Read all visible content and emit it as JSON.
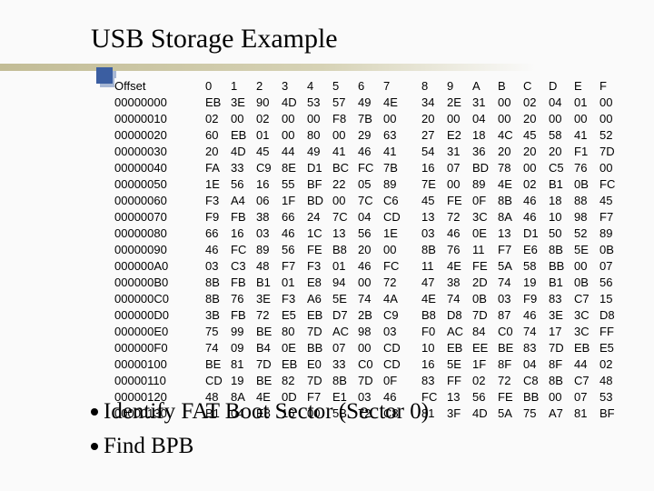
{
  "title": "USB Storage Example",
  "hex": {
    "header": [
      "Offset",
      "0",
      "1",
      "2",
      "3",
      "4",
      "5",
      "6",
      "7",
      "8",
      "9",
      "A",
      "B",
      "C",
      "D",
      "E",
      "F"
    ],
    "rows": [
      {
        "offset": "00000000",
        "bytes": [
          "EB",
          "3E",
          "90",
          "4D",
          "53",
          "57",
          "49",
          "4E",
          "34",
          "2E",
          "31",
          "00",
          "02",
          "04",
          "01",
          "00"
        ]
      },
      {
        "offset": "00000010",
        "bytes": [
          "02",
          "00",
          "02",
          "00",
          "00",
          "F8",
          "7B",
          "00",
          "20",
          "00",
          "04",
          "00",
          "20",
          "00",
          "00",
          "00"
        ]
      },
      {
        "offset": "00000020",
        "bytes": [
          "60",
          "EB",
          "01",
          "00",
          "80",
          "00",
          "29",
          "63",
          "27",
          "E2",
          "18",
          "4C",
          "45",
          "58",
          "41",
          "52"
        ]
      },
      {
        "offset": "00000030",
        "bytes": [
          "20",
          "4D",
          "45",
          "44",
          "49",
          "41",
          "46",
          "41",
          "54",
          "31",
          "36",
          "20",
          "20",
          "20",
          "F1",
          "7D"
        ]
      },
      {
        "offset": "00000040",
        "bytes": [
          "FA",
          "33",
          "C9",
          "8E",
          "D1",
          "BC",
          "FC",
          "7B",
          "16",
          "07",
          "BD",
          "78",
          "00",
          "C5",
          "76",
          "00"
        ]
      },
      {
        "offset": "00000050",
        "bytes": [
          "1E",
          "56",
          "16",
          "55",
          "BF",
          "22",
          "05",
          "89",
          "7E",
          "00",
          "89",
          "4E",
          "02",
          "B1",
          "0B",
          "FC"
        ]
      },
      {
        "offset": "00000060",
        "bytes": [
          "F3",
          "A4",
          "06",
          "1F",
          "BD",
          "00",
          "7C",
          "C6",
          "45",
          "FE",
          "0F",
          "8B",
          "46",
          "18",
          "88",
          "45"
        ]
      },
      {
        "offset": "00000070",
        "bytes": [
          "F9",
          "FB",
          "38",
          "66",
          "24",
          "7C",
          "04",
          "CD",
          "13",
          "72",
          "3C",
          "8A",
          "46",
          "10",
          "98",
          "F7"
        ]
      },
      {
        "offset": "00000080",
        "bytes": [
          "66",
          "16",
          "03",
          "46",
          "1C",
          "13",
          "56",
          "1E",
          "03",
          "46",
          "0E",
          "13",
          "D1",
          "50",
          "52",
          "89"
        ]
      },
      {
        "offset": "00000090",
        "bytes": [
          "46",
          "FC",
          "89",
          "56",
          "FE",
          "B8",
          "20",
          "00",
          "8B",
          "76",
          "11",
          "F7",
          "E6",
          "8B",
          "5E",
          "0B"
        ]
      },
      {
        "offset": "000000A0",
        "bytes": [
          "03",
          "C3",
          "48",
          "F7",
          "F3",
          "01",
          "46",
          "FC",
          "11",
          "4E",
          "FE",
          "5A",
          "58",
          "BB",
          "00",
          "07"
        ]
      },
      {
        "offset": "000000B0",
        "bytes": [
          "8B",
          "FB",
          "B1",
          "01",
          "E8",
          "94",
          "00",
          "72",
          "47",
          "38",
          "2D",
          "74",
          "19",
          "B1",
          "0B",
          "56"
        ]
      },
      {
        "offset": "000000C0",
        "bytes": [
          "8B",
          "76",
          "3E",
          "F3",
          "A6",
          "5E",
          "74",
          "4A",
          "4E",
          "74",
          "0B",
          "03",
          "F9",
          "83",
          "C7",
          "15"
        ]
      },
      {
        "offset": "000000D0",
        "bytes": [
          "3B",
          "FB",
          "72",
          "E5",
          "EB",
          "D7",
          "2B",
          "C9",
          "B8",
          "D8",
          "7D",
          "87",
          "46",
          "3E",
          "3C",
          "D8"
        ]
      },
      {
        "offset": "000000E0",
        "bytes": [
          "75",
          "99",
          "BE",
          "80",
          "7D",
          "AC",
          "98",
          "03",
          "F0",
          "AC",
          "84",
          "C0",
          "74",
          "17",
          "3C",
          "FF"
        ]
      },
      {
        "offset": "000000F0",
        "bytes": [
          "74",
          "09",
          "B4",
          "0E",
          "BB",
          "07",
          "00",
          "CD",
          "10",
          "EB",
          "EE",
          "BE",
          "83",
          "7D",
          "EB",
          "E5"
        ]
      },
      {
        "offset": "00000100",
        "bytes": [
          "BE",
          "81",
          "7D",
          "EB",
          "E0",
          "33",
          "C0",
          "CD",
          "16",
          "5E",
          "1F",
          "8F",
          "04",
          "8F",
          "44",
          "02"
        ]
      },
      {
        "offset": "00000110",
        "bytes": [
          "CD",
          "19",
          "BE",
          "82",
          "7D",
          "8B",
          "7D",
          "0F",
          "83",
          "FF",
          "02",
          "72",
          "C8",
          "8B",
          "C7",
          "48"
        ]
      },
      {
        "offset": "00000120",
        "bytes": [
          "48",
          "8A",
          "4E",
          "0D",
          "F7",
          "E1",
          "03",
          "46",
          "FC",
          "13",
          "56",
          "FE",
          "BB",
          "00",
          "07",
          "53"
        ]
      },
      {
        "offset": "00000130",
        "bytes": [
          "B1",
          "04",
          "E8",
          "16",
          "00",
          "5B",
          "72",
          "C8",
          "81",
          "3F",
          "4D",
          "5A",
          "75",
          "A7",
          "81",
          "BF"
        ]
      }
    ]
  },
  "bullets": [
    "Identify FAT Boot Sector (Sector 0)",
    "Find BPB"
  ]
}
